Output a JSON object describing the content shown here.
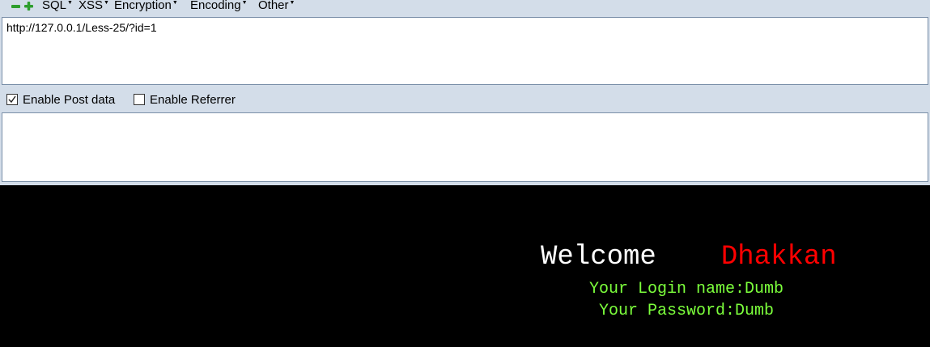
{
  "hackbar": {
    "toolbar": {
      "icons": [
        "remove-icon",
        "add-icon"
      ],
      "menus": [
        {
          "label": "SQL"
        },
        {
          "label": "XSS"
        },
        {
          "label": "Encryption"
        },
        {
          "label": "Encoding"
        },
        {
          "label": "Other"
        }
      ],
      "accent_color": "#2e9e2e"
    },
    "url_value": "http://127.0.0.1/Less-25/?id=1",
    "options": {
      "post_data": {
        "label": "Enable Post data",
        "checked": true
      },
      "referrer": {
        "label": "Enable Referrer",
        "checked": false
      }
    },
    "post_value": ""
  },
  "output": {
    "welcome": "Welcome",
    "name": "Dhakkan",
    "login_line": "Your Login name:Dumb",
    "password_line": "Your Password:Dumb",
    "colors": {
      "welcome": "#ffffff",
      "name": "#ff0000",
      "info": "#7cff3c",
      "background": "#000000"
    }
  }
}
